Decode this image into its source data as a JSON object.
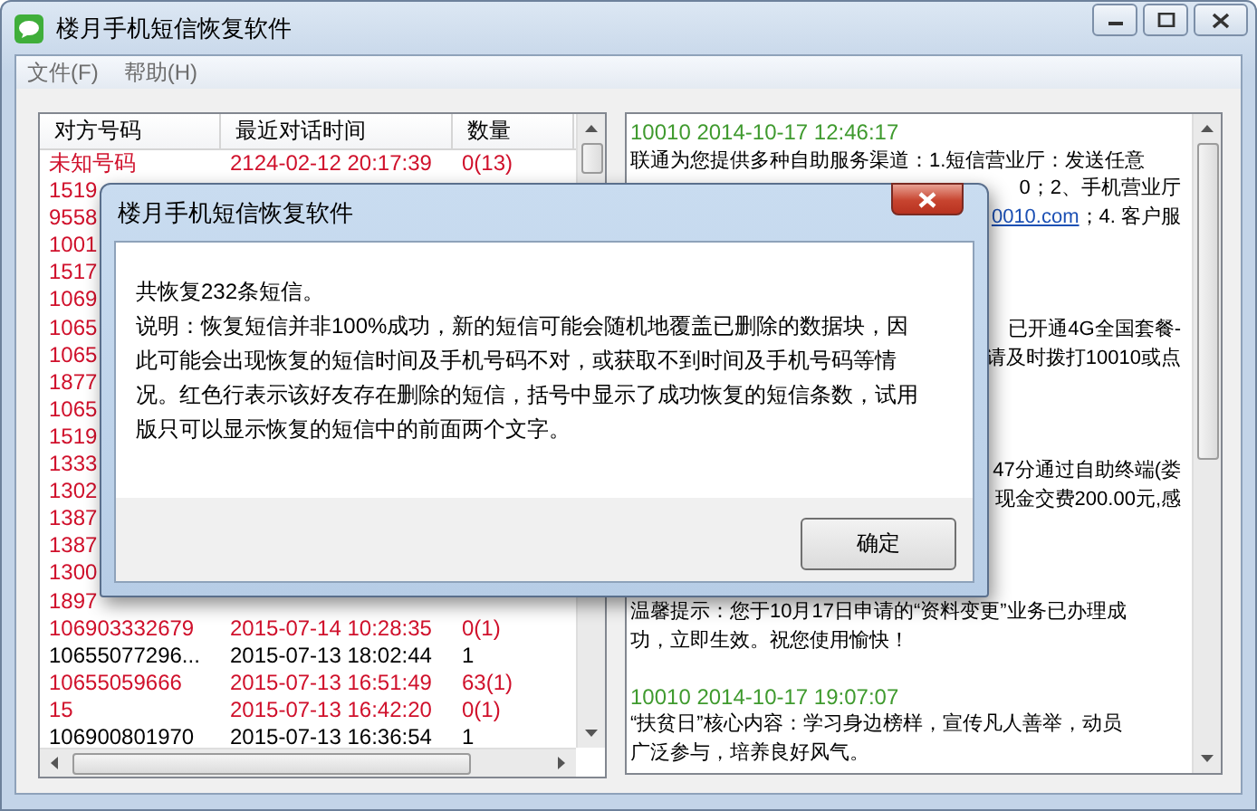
{
  "window": {
    "title": "楼月手机短信恢复软件"
  },
  "menu": [
    "文件(F)",
    "帮助(H)"
  ],
  "contacts": {
    "columns": [
      "对方号码",
      "最近对话时间",
      "数量"
    ],
    "rows": [
      {
        "number": "未知号码",
        "time": "2124-02-12 20:17:39",
        "count": "0(13)",
        "deleted": true
      },
      {
        "number": "1519",
        "deleted": true
      },
      {
        "number": "9558",
        "deleted": true
      },
      {
        "number": "1001",
        "deleted": true
      },
      {
        "number": "1517",
        "deleted": true
      },
      {
        "number": "1069",
        "deleted": true
      },
      {
        "number": "1065",
        "deleted": true
      },
      {
        "number": "1065",
        "deleted": true
      },
      {
        "number": "1877",
        "deleted": true
      },
      {
        "number": "1065",
        "deleted": true
      },
      {
        "number": "1519",
        "deleted": true
      },
      {
        "number": "1333",
        "deleted": true
      },
      {
        "number": "1302",
        "deleted": true
      },
      {
        "number": "1387",
        "deleted": true
      },
      {
        "number": "1387",
        "deleted": true
      },
      {
        "number": "1300",
        "deleted": true
      },
      {
        "number": "1897",
        "deleted": true
      },
      {
        "number": "106903332679",
        "time": "2015-07-14 10:28:35",
        "count": "0(1)",
        "deleted": true
      },
      {
        "number": "10655077296...",
        "time": "2015-07-13 18:02:44",
        "count": "1",
        "deleted": false
      },
      {
        "number": "10655059666",
        "time": "2015-07-13 16:51:49",
        "count": "63(1)",
        "deleted": true
      },
      {
        "number": "15",
        "time": "2015-07-13 16:42:20",
        "count": "0(1)",
        "deleted": true
      },
      {
        "number": "106900801970",
        "time": "2015-07-13 16:36:54",
        "count": "1",
        "deleted": false
      }
    ]
  },
  "messages": [
    {
      "kind": "header",
      "text": "10010 2014-10-17 12:46:17"
    },
    {
      "kind": "body",
      "text": "联通为您提供多种自助服务渠道：1.短信营业厅：发送任意"
    },
    {
      "kind": "partial",
      "text": "0；2、手机营业厅"
    },
    {
      "kind": "partial",
      "link": "0010.com",
      "text": "；4. 客户服"
    },
    {
      "kind": "blank"
    },
    {
      "kind": "blank"
    },
    {
      "kind": "blank"
    },
    {
      "kind": "partial",
      "text": "已开通4G全国套餐-"
    },
    {
      "kind": "partial",
      "text": "请及时拨打10010或点"
    },
    {
      "kind": "blank"
    },
    {
      "kind": "blank"
    },
    {
      "kind": "blank"
    },
    {
      "kind": "partial",
      "text": "47分通过自助终端(娄"
    },
    {
      "kind": "partial",
      "text": "现金交费200.00元,感"
    },
    {
      "kind": "blank"
    },
    {
      "kind": "blank"
    },
    {
      "kind": "blank"
    },
    {
      "kind": "body",
      "text": "温馨提示：您于10月17日申请的“资料变更”业务已办理成"
    },
    {
      "kind": "body",
      "text": "功，立即生效。祝您使用愉快！"
    },
    {
      "kind": "blank"
    },
    {
      "kind": "header",
      "text": "10010 2014-10-17 19:07:07"
    },
    {
      "kind": "body",
      "text": "“扶贫日”核心内容：学习身边榜样，宣传凡人善举，动员"
    },
    {
      "kind": "body",
      "text": "广泛参与，培养良好风气。"
    }
  ],
  "dialog": {
    "title": "楼月手机短信恢复软件",
    "summary": "共恢复232条短信。",
    "note": "说明：恢复短信并非100%成功，新的短信可能会随机地覆盖已删除的数据块，因此可能会出现恢复的短信时间及手机号码不对，或获取不到时间及手机号码等情况。红色行表示该好友存在删除的短信，括号中显示了成功恢复的短信条数，试用版只可以显示恢复的短信中的前面两个文字。",
    "buttons": [
      "确定"
    ]
  }
}
